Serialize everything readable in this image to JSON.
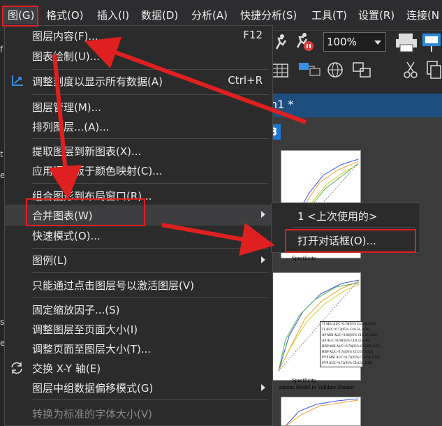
{
  "menubar": {
    "items": [
      {
        "label": "图(G)"
      },
      {
        "label": "格式(O)"
      },
      {
        "label": "插入(I)"
      },
      {
        "label": "数据(D)"
      },
      {
        "label": "分析(A)"
      },
      {
        "label": "快捷分析(S)"
      },
      {
        "label": "工具(T)"
      },
      {
        "label": "设置(R)"
      },
      {
        "label": "连接(N"
      }
    ]
  },
  "toolbar": {
    "zoom_value": "100%"
  },
  "document": {
    "tab_title": "h1 *",
    "page_number": "3",
    "axis_label": "Specificity",
    "axis_label_2": "Specificity",
    "caption": "rations Model in Validate Dataset",
    "legend": [
      "TI MSI AUC=0.78(95% CI:0.60,0.96)",
      "TI AUC=0.72(95% CI:0.56, 0.90)",
      "AP MSI AUC=0.66(95% CI:0.50, 0.88)",
      "AP AUC=0.69(95% CI:0.53,0.86)",
      "HBP MSI AUC=0.78(95% CI:0.60, 0.97)",
      "HBP AUC=0.74(95% CI:0.57, 0.92)",
      "PVP MSI AUC=0.75(95% CI:0.58, 0.93)",
      "PVP AUC=0.71(95% CI:0.54, 0.88)"
    ]
  },
  "menu": {
    "items": [
      {
        "label": "图层内容(F)...",
        "shortcut": "F12"
      },
      {
        "label": "图表绘制(U)..."
      },
      {
        "label": "调整刻度以显示所有数据(A)",
        "shortcut": "Ctrl+R"
      },
      {
        "label": "图层管理(M)..."
      },
      {
        "label": "排列图层...(A)..."
      },
      {
        "label": "提取图层到新图表(X)..."
      },
      {
        "label": "应用调色板于颜色映射(C)..."
      },
      {
        "label": "组合图形到布局窗口(R)..."
      },
      {
        "label": "合并图表(W)"
      },
      {
        "label": "快速模式(O)..."
      },
      {
        "label": "图例(L)"
      },
      {
        "label": "只能通过点击图层号以激活图层(V)"
      },
      {
        "label": "固定缩放因子...(S)"
      },
      {
        "label": "调整图层至页面大小(I)"
      },
      {
        "label": "调整页面至图层大小(T)..."
      },
      {
        "label": "交换 X-Y 轴(E)"
      },
      {
        "label": "图层中组数据偏移模式(G)"
      },
      {
        "label": "转换为标准的字体大小(V)"
      }
    ]
  },
  "submenu": {
    "items": [
      {
        "label": "1 <上次使用的>"
      },
      {
        "label": "打开对话框(O)..."
      }
    ]
  },
  "colors": {
    "highlight": "#e02020",
    "menu_bg": "#2b2b2b",
    "tab_blue": "#1c4f80"
  }
}
